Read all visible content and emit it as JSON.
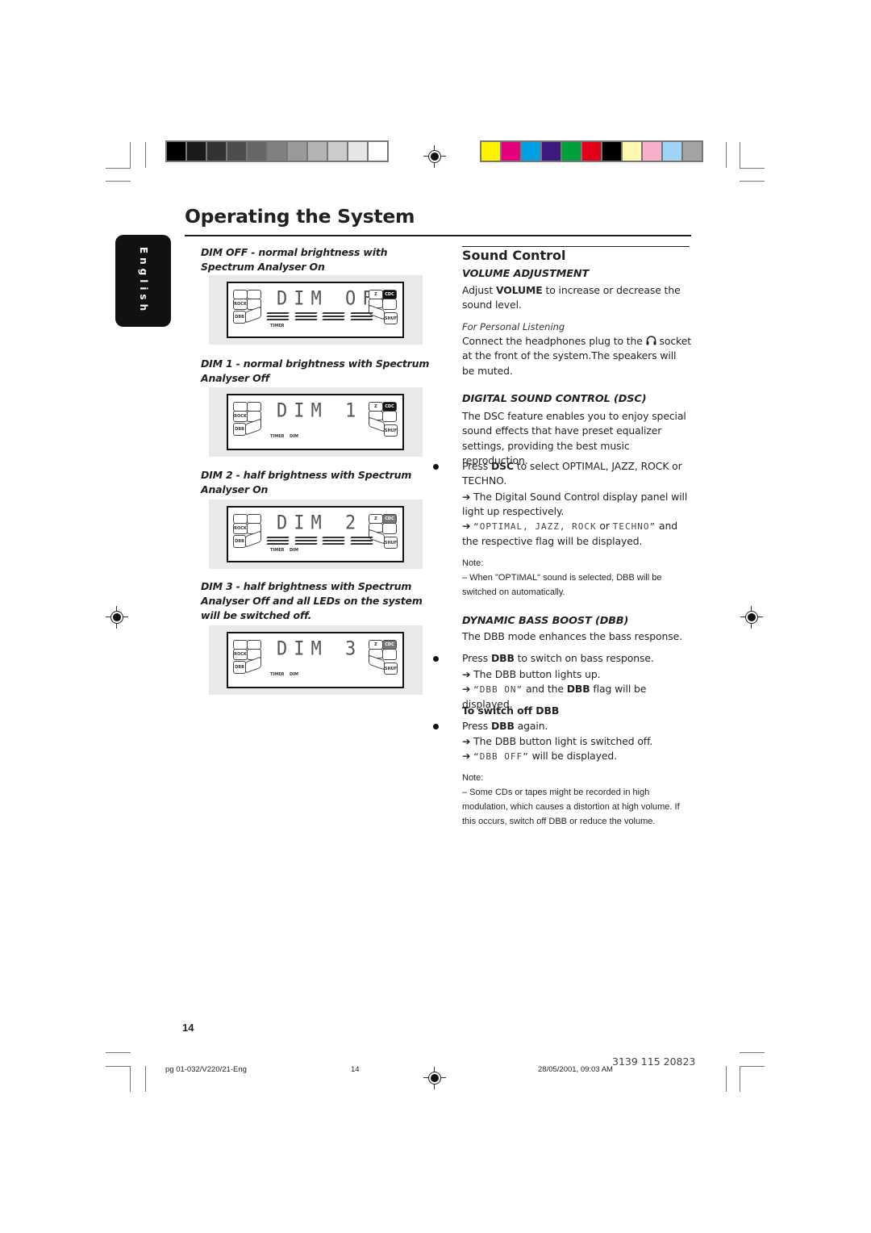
{
  "print_marks": {
    "grayscale_swatches": [
      "#000000",
      "#1a1a1a",
      "#333333",
      "#4d4d4d",
      "#666666",
      "#808080",
      "#999999",
      "#b3b3b3",
      "#cccccc",
      "#e6e6e6",
      "#ffffff"
    ],
    "color_swatches": [
      "#fff200",
      "#e6007e",
      "#00a0e3",
      "#3d1a7d",
      "#00a03c",
      "#e2001a",
      "#000000",
      "#fff9b0",
      "#f7b0cc",
      "#a0d4f5",
      "#a3a3a3"
    ]
  },
  "page": {
    "title": "Operating the System",
    "language_tab": "English",
    "page_number": "14"
  },
  "left_column": {
    "displays": [
      {
        "caption": "DIM OFF - normal brightness with Spectrum Analyser On",
        "lcd_text": "DIM OFF",
        "spectrum": true,
        "labels": [
          "TIMER"
        ]
      },
      {
        "caption": "DIM 1 - normal brightness with Spectrum Analyser Off",
        "lcd_text": "DIM 1",
        "spectrum": false,
        "labels": [
          "TIMER",
          "DIM"
        ]
      },
      {
        "caption": "DIM 2 - half brightness with Spectrum Analyser On",
        "lcd_text": "DIM 2",
        "spectrum": true,
        "labels": [
          "TIMER",
          "DIM"
        ]
      },
      {
        "caption": "DIM 3 - half brightness with Spectrum Analyser Off and all LEDs on the system will be switched off.",
        "lcd_text": "DIM 3",
        "spectrum": false,
        "labels": [
          "TIMER",
          "DIM"
        ]
      }
    ],
    "lcd_flags": {
      "rock": "ROCK",
      "dbb": "DBB",
      "cdc": "CDC",
      "z": "Z",
      "shuf": "SHUF"
    }
  },
  "right_column": {
    "section_title": "Sound Control",
    "volume": {
      "heading": "VOLUME ADJUSTMENT",
      "text_pre": "Adjust ",
      "text_bold": "VOLUME",
      "text_post": " to increase or decrease the sound level.",
      "personal_heading": "For Personal Listening",
      "personal_pre": "Connect the headphones plug to the ",
      "personal_post": " socket at the front of the system.The speakers will be muted."
    },
    "dsc": {
      "heading": "DIGITAL SOUND CONTROL  (DSC)",
      "intro": "The DSC feature enables you to enjoy special sound effects that have preset equalizer settings, providing the best music reproduction.",
      "step_pre": "Press ",
      "step_bold": "DSC",
      "step_post": " to select OPTIMAL, JAZZ, ROCK or TECHNO.",
      "result1": "The Digital Sound Control display panel will light up respectively.",
      "result2_lcd1": "“OPTIMAL, JAZZ, ROCK",
      "result2_or": " or ",
      "result2_lcd2": "TECHNO”",
      "result2_post": " and the respective flag will be displayed.",
      "note_label": "Note:",
      "note_text": "–  When \"OPTIMAL\" sound is selected, DBB will be switched on automatically."
    },
    "dbb": {
      "heading": "DYNAMIC BASS BOOST (DBB)",
      "intro": "The DBB mode enhances the bass response.",
      "step_pre": "Press ",
      "step_bold": "DBB",
      "step_post": " to switch on bass response.",
      "result1": "The DBB button lights up.",
      "result2_lcd": "“DBB ON”",
      "result2_mid": " and the ",
      "result2_bold": "DBB",
      "result2_post": " flag will be displayed.",
      "off_heading": "To switch off DBB",
      "off_step_pre": "Press ",
      "off_step_bold": "DBB",
      "off_step_post": " again.",
      "off_result1": "The DBB button light is switched off.",
      "off_result2_lcd": "“DBB OFF”",
      "off_result2_post": " will be displayed.",
      "note_label": "Note:",
      "note_text": "–  Some CDs or tapes might be recorded in high modulation, which causes a distortion at high volume. If this occurs, switch off DBB or reduce the volume."
    }
  },
  "footer": {
    "file": "pg 01-032/V220/21-Eng",
    "page": "14",
    "datetime": "28/05/2001, 09:03 AM",
    "code": "3139 115 20823"
  },
  "icons": {
    "arrow": "➔",
    "headphones": "headphones-icon"
  }
}
